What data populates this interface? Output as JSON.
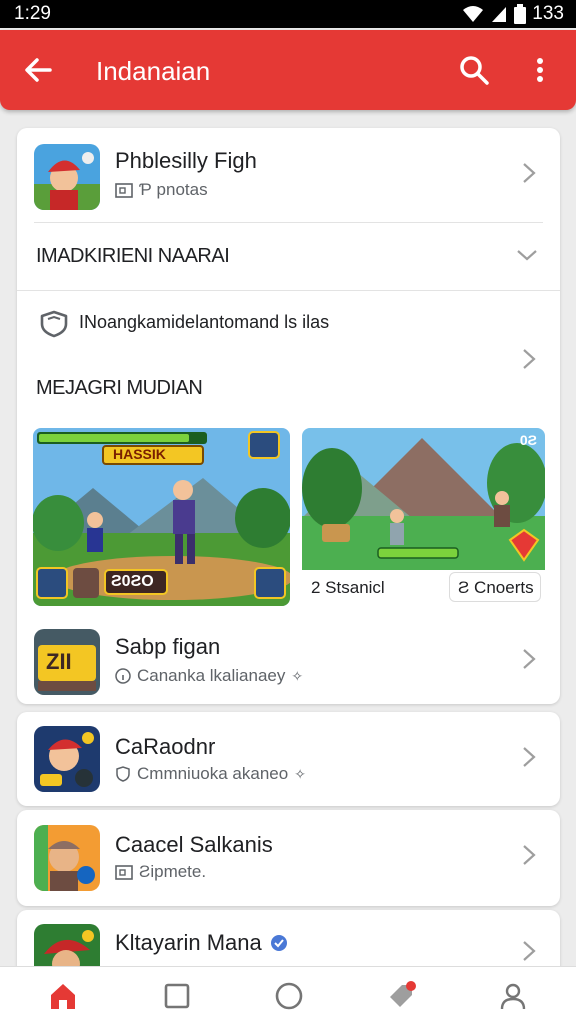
{
  "status_bar": {
    "time": "1:29",
    "battery": "133"
  },
  "app_bar": {
    "title": "Indanaian"
  },
  "featured_app": {
    "title": "Phblesilly Figh",
    "subtitle": "Ƥ pnotas"
  },
  "section_one": {
    "title": "IMADKIRIENI NAARAI"
  },
  "notice": {
    "text": "INoangkamidelantomand ls ilas"
  },
  "section_two": {
    "title": "MEJAGRI MUDIAN"
  },
  "screenshots": {
    "left": {
      "hud_text": "HASSIK",
      "score": "Ƨ0ƧO"
    },
    "right": {
      "counter": "0Ƨ",
      "label": "2 Stsanicl",
      "button": "Ƨ Cnoerts"
    }
  },
  "apps": [
    {
      "title": "Sabp figan",
      "subtitle": "Canankа lkalianaey",
      "icon_text": "ZII"
    },
    {
      "title": "CaRaodnr",
      "subtitle": "Cmmniuoka akaneo"
    },
    {
      "title": "Caacel Salkanis",
      "subtitle": "Ƨipmete."
    },
    {
      "title": "Kltayarin Mana",
      "subtitle": ""
    }
  ],
  "colors": {
    "accent": "#e53935",
    "text": "#202124",
    "muted": "#5f6368"
  }
}
